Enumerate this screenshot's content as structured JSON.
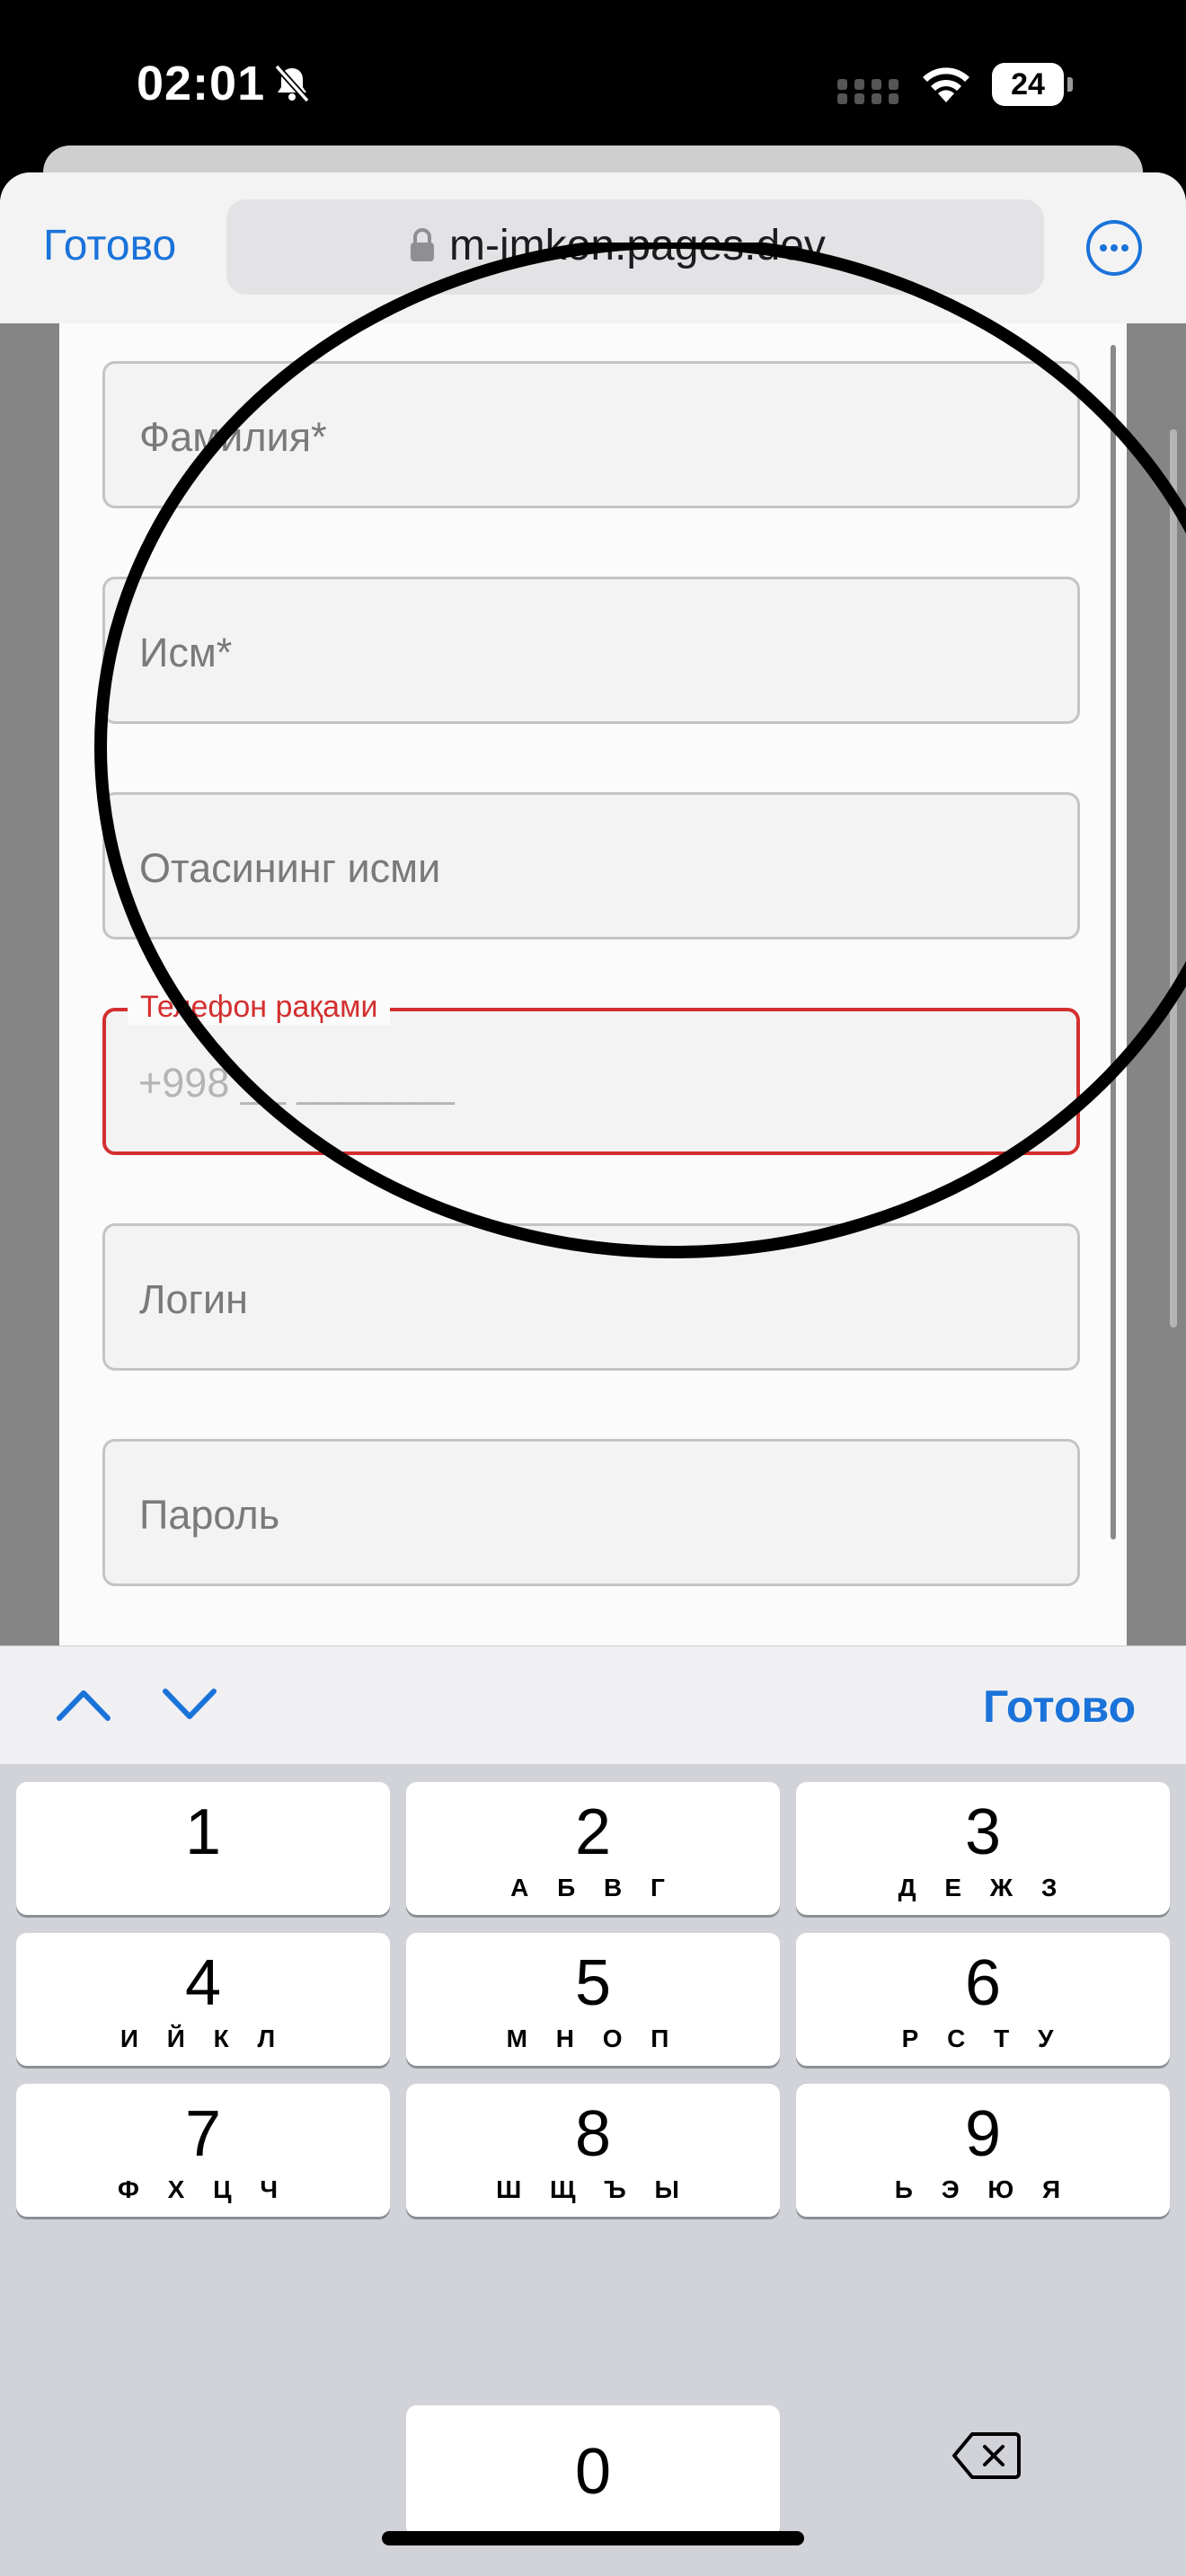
{
  "status_bar": {
    "time": "02:01",
    "battery": "24",
    "icons": [
      "bell-slash-icon",
      "cellular-icon",
      "wifi-icon",
      "battery-icon"
    ]
  },
  "browser": {
    "done_label": "Готово",
    "url": "m-imkon.pages.dev",
    "icons": [
      "lock-icon",
      "more-icon"
    ]
  },
  "form": {
    "fields": [
      {
        "placeholder": "Фамилия*"
      },
      {
        "placeholder": "Исм*"
      },
      {
        "placeholder": "Отасининг исми"
      },
      {
        "label": "Телефон рақами",
        "placeholder": "+998 __ _______",
        "state": "focused-error",
        "border_color": "#d32f2f"
      },
      {
        "placeholder": "Логин"
      },
      {
        "placeholder": "Пароль"
      }
    ]
  },
  "accessory_bar": {
    "done_label": "Готово",
    "icons": [
      "chevron-up-icon",
      "chevron-down-icon"
    ]
  },
  "keypad": {
    "keys": [
      {
        "digit": "1",
        "letters": ""
      },
      {
        "digit": "2",
        "letters": "А Б В Г"
      },
      {
        "digit": "3",
        "letters": "Д Е Ж З"
      },
      {
        "digit": "4",
        "letters": "И Й К Л"
      },
      {
        "digit": "5",
        "letters": "М Н О П"
      },
      {
        "digit": "6",
        "letters": "Р С Т У"
      },
      {
        "digit": "7",
        "letters": "Ф Х Ц Ч"
      },
      {
        "digit": "8",
        "letters": "Ш Щ Ъ Ы"
      },
      {
        "digit": "9",
        "letters": "Ь Э Ю Я"
      },
      {
        "digit": "0",
        "letters": ""
      }
    ],
    "delete_icon": "delete-backspace-icon"
  },
  "colors": {
    "accent": "#1a73d9",
    "error": "#d32f2f",
    "annotation": "#000000"
  }
}
